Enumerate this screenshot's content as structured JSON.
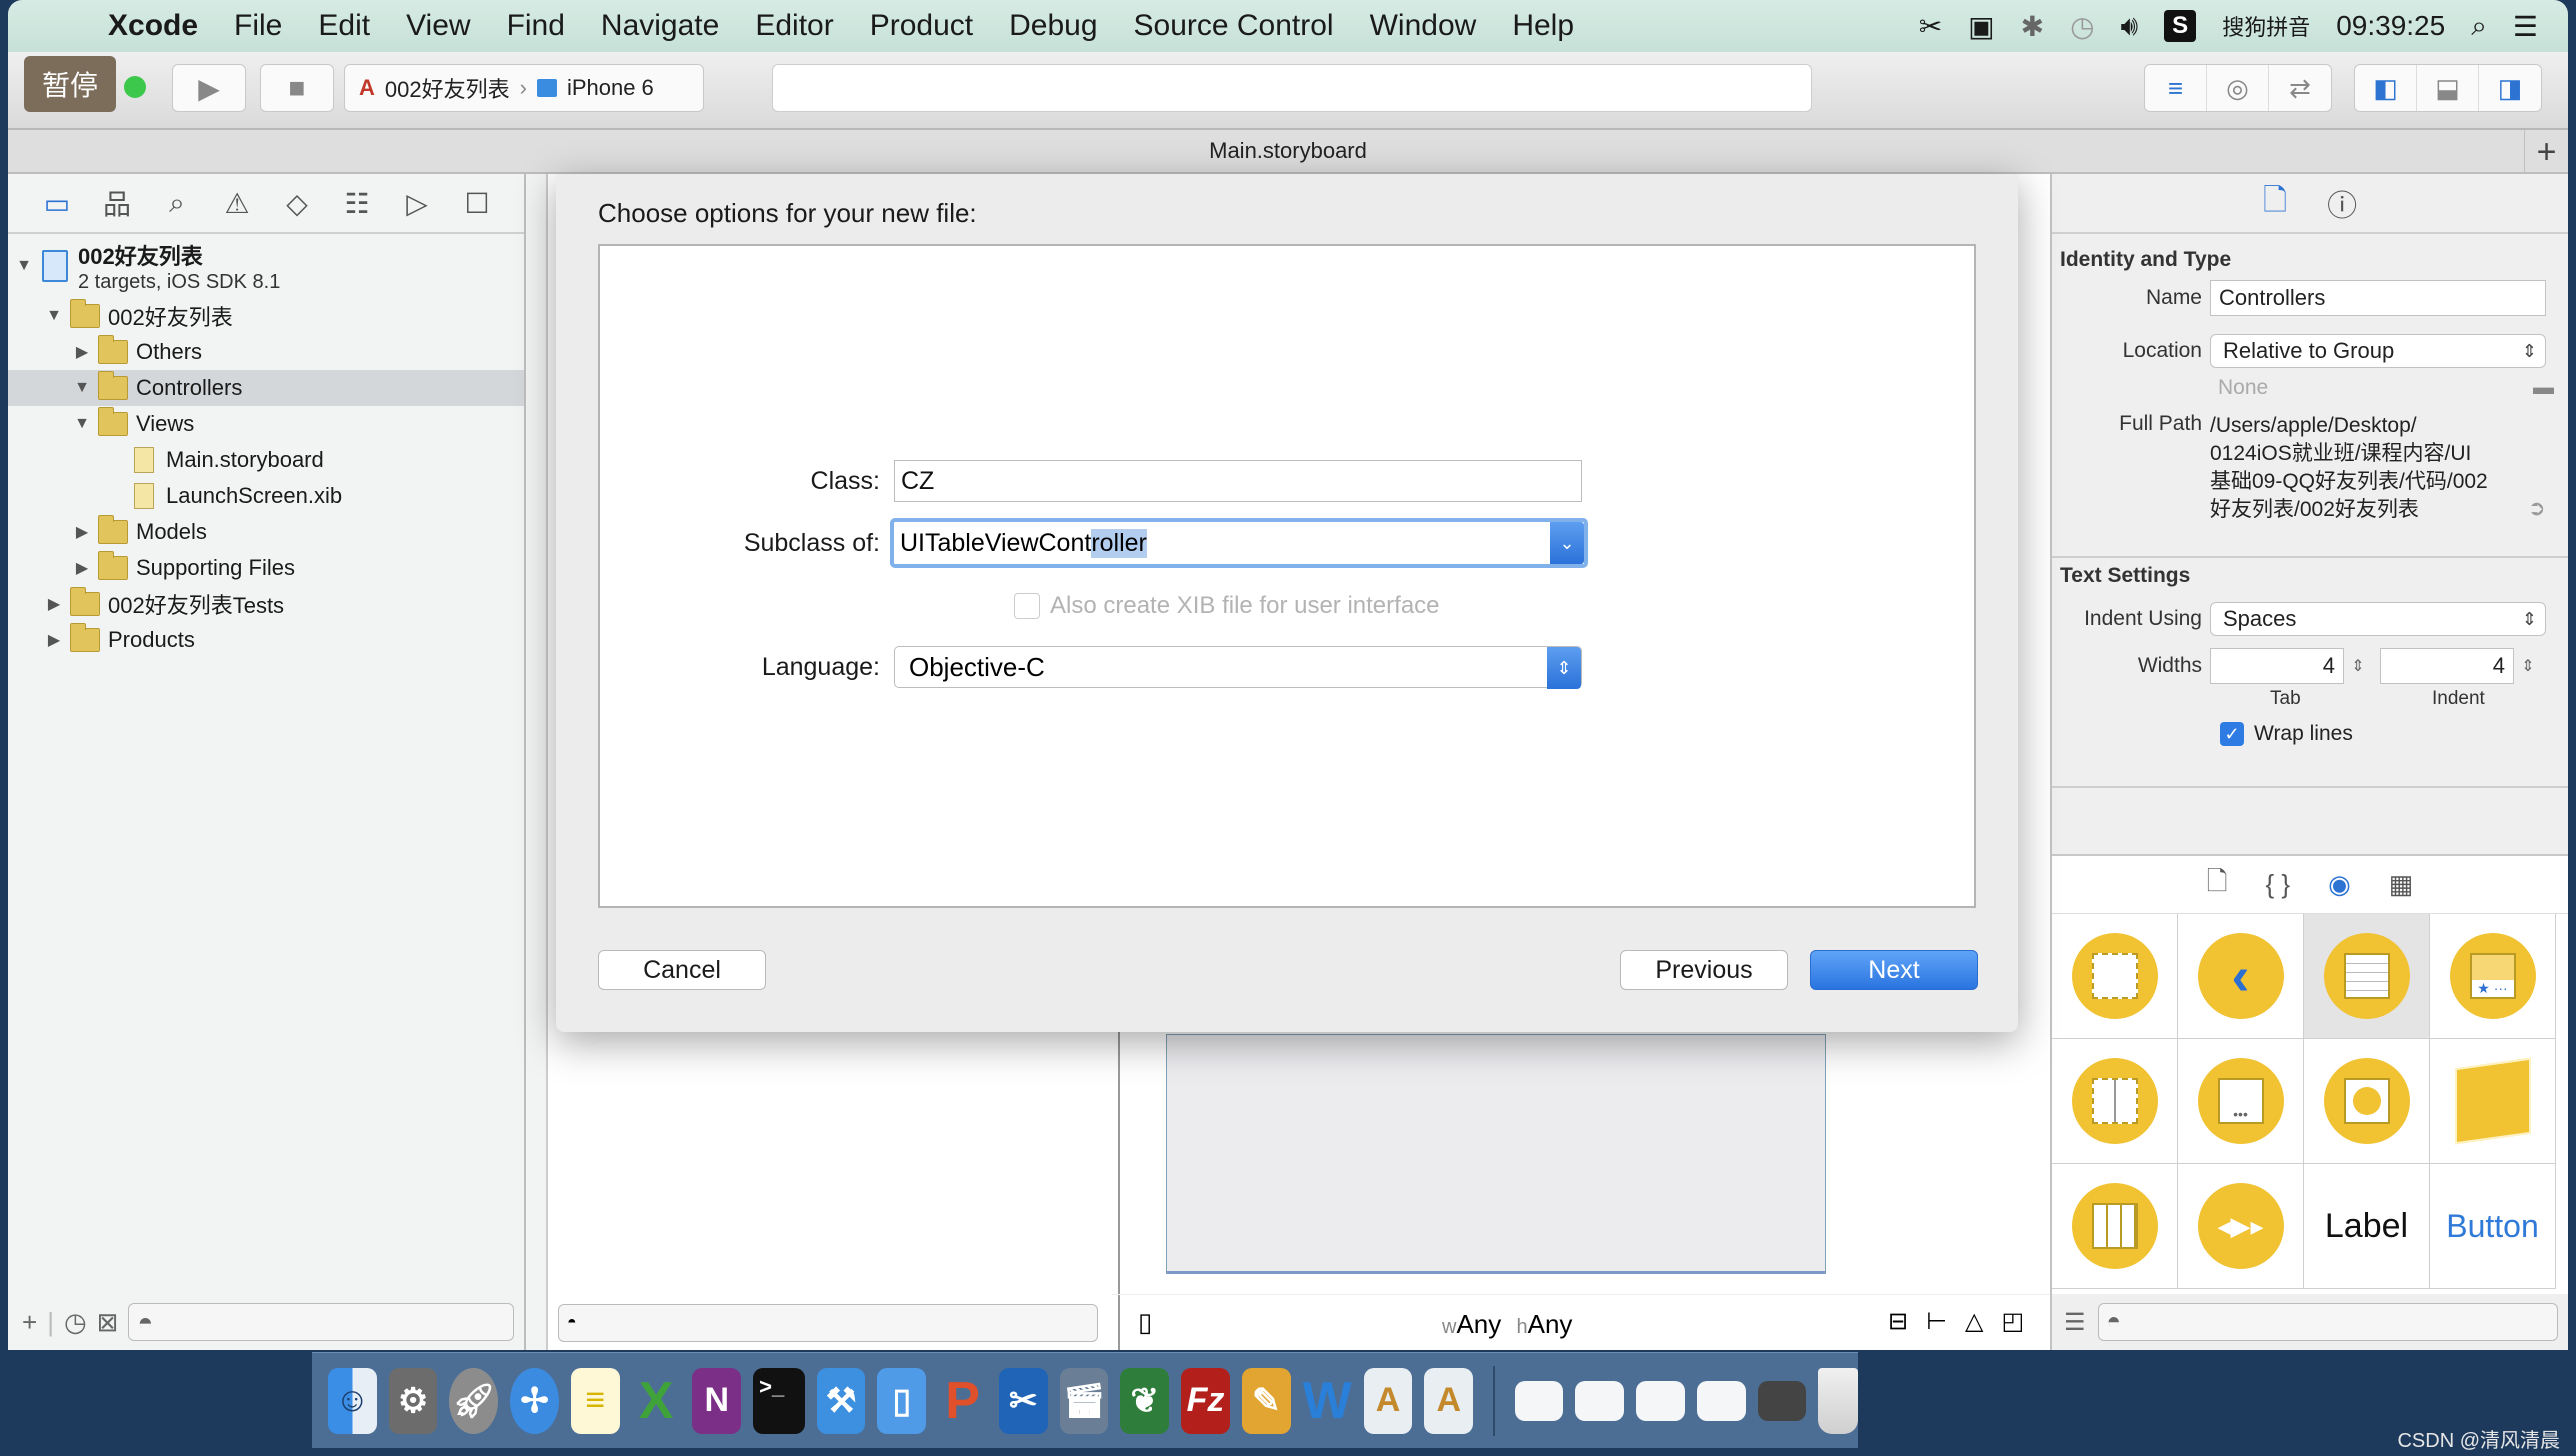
{
  "menubar": {
    "app": "Xcode",
    "items": [
      "File",
      "Edit",
      "View",
      "Find",
      "Navigate",
      "Editor",
      "Product",
      "Debug",
      "Source Control",
      "Window",
      "Help"
    ],
    "input_method": "搜狗拼音",
    "clock": "09:39:25"
  },
  "toolbar": {
    "pause_label": "暂停",
    "scheme_project": "002好友列表",
    "scheme_device": "iPhone 6"
  },
  "tab": {
    "title": "Main.storyboard"
  },
  "navigator": {
    "project": {
      "name": "002好友列表",
      "subtitle": "2 targets, iOS SDK 8.1"
    },
    "tree": [
      {
        "label": "002好友列表",
        "level": 1,
        "type": "folder",
        "expanded": true
      },
      {
        "label": "Others",
        "level": 2,
        "type": "folder",
        "expanded": false
      },
      {
        "label": "Controllers",
        "level": 2,
        "type": "folder",
        "expanded": true,
        "selected": true
      },
      {
        "label": "Views",
        "level": 2,
        "type": "folder",
        "expanded": true
      },
      {
        "label": "Main.storyboard",
        "level": 3,
        "type": "file"
      },
      {
        "label": "LaunchScreen.xib",
        "level": 3,
        "type": "file"
      },
      {
        "label": "Models",
        "level": 2,
        "type": "folder",
        "expanded": false
      },
      {
        "label": "Supporting Files",
        "level": 2,
        "type": "folder",
        "expanded": false
      },
      {
        "label": "002好友列表Tests",
        "level": 1,
        "type": "folder",
        "expanded": false
      },
      {
        "label": "Products",
        "level": 1,
        "type": "folder",
        "expanded": false
      }
    ]
  },
  "editor": {
    "size_class_w": "Any",
    "size_class_h": "Any",
    "w_prefix": "w",
    "h_prefix": "h"
  },
  "dialog": {
    "title": "Choose options for your new file:",
    "class_label": "Class:",
    "class_value": "CZ",
    "subclass_label": "Subclass of:",
    "subclass_value_plain": "UITableViewCont",
    "subclass_value_selected": "roller",
    "xib_label": "Also create XIB file for user interface",
    "xib_checked": false,
    "xib_enabled": false,
    "language_label": "Language:",
    "language_value": "Objective-C",
    "cancel": "Cancel",
    "previous": "Previous",
    "next": "Next"
  },
  "inspector": {
    "identity_section": "Identity and Type",
    "name_label": "Name",
    "name_value": "Controllers",
    "location_label": "Location",
    "location_value": "Relative to Group",
    "location_placeholder": "None",
    "fullpath_label": "Full Path",
    "fullpath_lines": [
      "/Users/apple/Desktop/",
      "0124iOS就业班/课程内容/UI",
      "基础09-QQ好友列表/代码/002",
      "好友列表/002好友列表"
    ],
    "text_section": "Text Settings",
    "indent_label": "Indent Using",
    "indent_value": "Spaces",
    "widths_label": "Widths",
    "tab_width": "4",
    "indent_width": "4",
    "tab_caption": "Tab",
    "indent_caption": "Indent",
    "wrap_label": "Wrap lines",
    "wrap_checked": true
  },
  "library": {
    "items": [
      "View Controller",
      "Navigation Controller",
      "Table View Controller",
      "Tab Bar Controller",
      "Split View Controller",
      "Page View Controller",
      "GLKit View Controller",
      "Object",
      "Collection View Controller",
      "AV Player View Controller",
      "Label",
      "Button"
    ],
    "label_text": "Label",
    "button_text": "Button"
  },
  "dock": {
    "apps": [
      "Finder",
      "System Preferences",
      "Launchpad",
      "Safari",
      "Notes",
      "Excel",
      "OneNote",
      "Terminal",
      "Xcode",
      "Simulator",
      "PowerPoint",
      "Screenshot",
      "iMovie",
      "Sequel",
      "FileZilla",
      "Instruments",
      "Word",
      "Instruments Doc 1",
      "Instruments Doc 2"
    ],
    "minimized": 5
  },
  "watermark": "CSDN @清风清晨"
}
